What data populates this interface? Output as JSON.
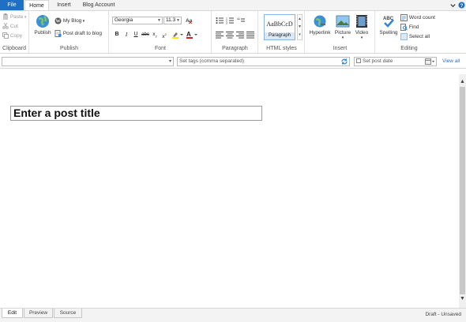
{
  "tabs": [
    "File",
    "Home",
    "Insert",
    "Blog Account"
  ],
  "colors": {
    "accent": "#1f6fc4",
    "ribbon_bg": "#ffffff",
    "chrome_bg": "#f3f3f3"
  },
  "clipboard": {
    "paste": "Paste",
    "cut": "Cut",
    "copy": "Copy",
    "label": "Clipboard"
  },
  "publish": {
    "publish": "Publish",
    "blog": "My Blog",
    "draft": "Post draft to blog",
    "label": "Publish"
  },
  "font": {
    "family": "Georgia",
    "size": "11.3",
    "label": "Font"
  },
  "paragraph": {
    "label": "Paragraph"
  },
  "html_styles": {
    "sample": "AaBbCcD",
    "style_name": "Paragraph",
    "label": "HTML styles"
  },
  "insert": {
    "hyperlink": "Hyperlink",
    "picture": "Picture",
    "video": "Video",
    "label": "Insert"
  },
  "editing": {
    "spelling": "Spelling",
    "word_count": "Word count",
    "find": "Find",
    "select_all": "Select all",
    "label": "Editing"
  },
  "tagbar": {
    "tags_placeholder": "Set tags (comma separated)",
    "post_date": "Set post date",
    "view_all": "View all"
  },
  "editor": {
    "title_placeholder": "Enter a post title"
  },
  "view_tabs": [
    "Edit",
    "Preview",
    "Source"
  ],
  "status": "Draft - Unsaved"
}
